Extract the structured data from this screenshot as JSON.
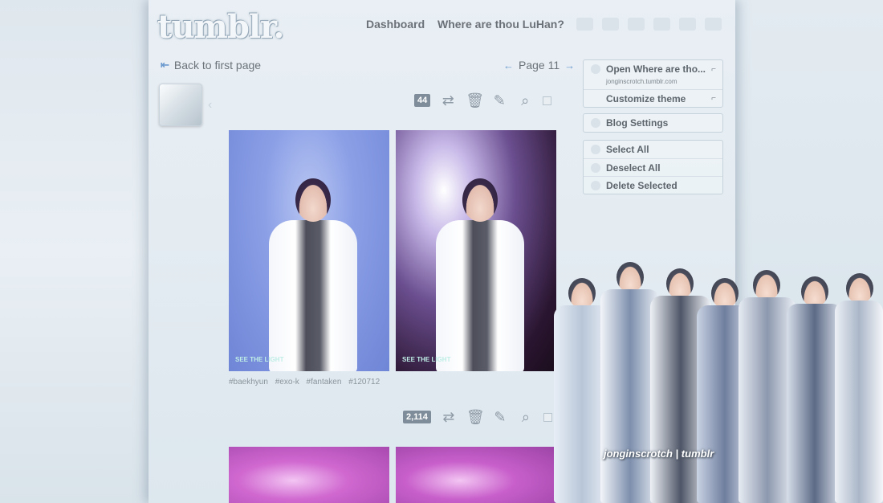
{
  "header": {
    "logo": "tumblr.",
    "nav": [
      {
        "label": "Dashboard"
      },
      {
        "label": "Where are thou LuHan?"
      }
    ]
  },
  "pagination": {
    "back_label": "Back to first page",
    "page_label": "Page 11"
  },
  "posts": [
    {
      "notes": "44",
      "tags": "#baekhyun #exo-k #fantaken #120712",
      "watermark_1": "SEE THE LIGHT",
      "watermark_2": "SEE THE LIGHT"
    },
    {
      "notes": "2,114"
    }
  ],
  "sidebar": {
    "blog_title": "Open Where are tho...",
    "blog_url": "jonginscrotch.tumblr.com",
    "customize": "Customize theme",
    "settings": "Blog Settings",
    "select_all": "Select All",
    "deselect_all": "Deselect All",
    "delete_selected": "Delete Selected"
  },
  "background_watermark": "jonginscrotch | tumblr",
  "colors": {
    "accent_arrow": "#6d9bcf",
    "note_badge": "#7e8d99"
  }
}
